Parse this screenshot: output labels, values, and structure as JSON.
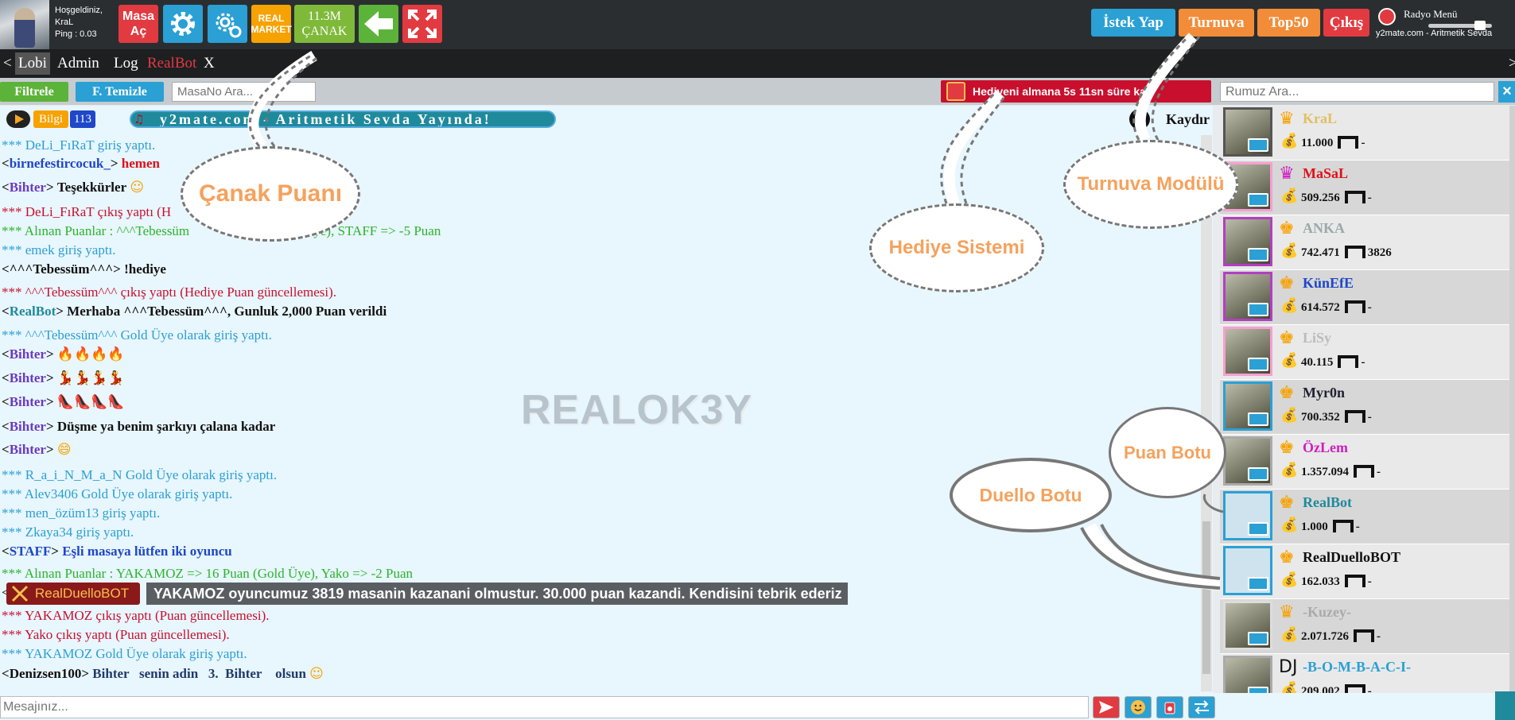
{
  "header": {
    "welcome": "Hoşgeldiniz,",
    "username": "KraL",
    "ping": "Ping : 0.03",
    "masa_ac": "Masa\nAç",
    "real_market": "REAL\nMARKET",
    "canak_value": "11.3M",
    "canak_label": "ÇANAK",
    "istek_yap": "İstek Yap",
    "turnuva": "Turnuva",
    "top50": "Top50",
    "cikis": "Çıkış",
    "radio_menu": "Radyo Menü",
    "radio_now": "y2mate.com - Aritmetik Sevda"
  },
  "tabs": {
    "prev": "<",
    "lobi": "Lobi",
    "admin": "Admin",
    "log": "Log",
    "realbot": "RealBot",
    "close": "X",
    "next": ">"
  },
  "filters": {
    "filtrele": "Filtrele",
    "temizle": "F. Temizle",
    "masa_placeholder": "MasaNo Ara...",
    "gift_text": "Hediyeni almana 5s 11sn süre ka",
    "rumuz_placeholder": "Rumuz Ara..."
  },
  "ticker": {
    "bilgi": "Bilgi",
    "count": "113",
    "marquee": "y2mate.com - Aritmetik Sevda  Yayında!",
    "kaydir": "Kaydır"
  },
  "chat": {
    "l1": "*** DeLi_FıRaT giriş yaptı.",
    "l2_nick": "birnefestircocuk_",
    "l2_msg": "hemen",
    "l3_nick": "Bihter",
    "l3_msg": "Teşekkürler",
    "l4": "*** DeLi_FıRaT çıkış yaptı (H",
    "l5": "*** Alınan Puanlar : ^^^Tebessüm",
    "l5b": "(Gold Üye), STAFF => -5 Puan",
    "l6": "*** emek giriş yaptı.",
    "l7_nick": "^^^Tebessüm^^^",
    "l7_msg": "!hediye",
    "l8": "*** ^^^Tebessüm^^^ çıkış yaptı (Hediye Puan güncellemesi).",
    "l9_nick": "RealBot",
    "l9_msg": "Merhaba ^^^Tebessüm^^^, Gunluk 2,000 Puan verildi",
    "l10": "*** ^^^Tebessüm^^^ Gold Üye olarak giriş yaptı.",
    "l11_nick": "Bihter",
    "l11_msg": "🔥🔥🔥🔥",
    "l12_nick": "Bihter",
    "l12_msg": "💃💃💃💃",
    "l13_nick": "Bihter",
    "l13_msg": "👠👠👠👠",
    "l14_nick": "Bihter",
    "l14_msg": "Düşme ya benim şarkıyı çalana kadar",
    "l15_nick": "Bihter",
    "l15_msg": "😄",
    "l16": "*** R_a_i_N_M_a_N Gold Üye olarak giriş yaptı.",
    "l17": "*** Alev3406 Gold Üye olarak giriş yaptı.",
    "l18": "*** men_özüm13 giriş yaptı.",
    "l19": "*** Zkaya34 giriş yaptı.",
    "l20_nick": "STAFF",
    "l20_msg": "Eşli masaya lütfen iki oyuncu",
    "l21": "*** Alınan Puanlar : YAKAMOZ => 16 Puan (Gold Üye), Yako => -2 Puan",
    "l22_nick": "RealDuelloBOT",
    "l22_msg": "YAKAMOZ oyuncumuz 3819 masanin kazanani olmustur. 30.000 puan kazandi. Kendisini tebrik ederiz",
    "l23": "*** YAKAMOZ çıkış yaptı (Puan güncellemesi).",
    "l24": "*** Yako çıkış yaptı (Puan güncellemesi).",
    "l25": "*** YAKAMOZ Gold Üye olarak giriş yaptı.",
    "l26_nick": "Denizsen100",
    "l26_msg": "Bihter   senin adin   3.  Bihter    olsun",
    "watermark": "REALOK3Y"
  },
  "users": [
    {
      "name": "KraL",
      "points": "11.000",
      "table": "-",
      "color": "#e0c060",
      "border": "#555"
    },
    {
      "name": "MaSaL",
      "points": "509.256",
      "table": "-",
      "color": "#e0101a",
      "border": "#f5a0d0"
    },
    {
      "name": "ANKA",
      "points": "742.471",
      "table": "3826",
      "color": "#9aa",
      "border": "#b040c0"
    },
    {
      "name": "KünEfE",
      "points": "614.572",
      "table": "-",
      "color": "#1f47c8",
      "border": "#b040c0"
    },
    {
      "name": "LiSy",
      "points": "40.115",
      "table": "-",
      "color": "#bbb",
      "border": "#f5a0d0"
    },
    {
      "name": "Myr0n",
      "points": "700.352",
      "table": "-",
      "color": "#223",
      "border": "#2aa0d4"
    },
    {
      "name": "ÖzLem",
      "points": "1.357.094",
      "table": "-",
      "color": "#d020c0",
      "border": "#aaa"
    },
    {
      "name": "RealBot",
      "points": "1.000",
      "table": "-",
      "color": "#1f8a9c",
      "border": "#2aa0d4"
    },
    {
      "name": "RealDuelloBOT",
      "points": "162.033",
      "table": "-",
      "color": "#111",
      "border": "#2aa0d4"
    },
    {
      "name": "-Kuzey-",
      "points": "2.071.726",
      "table": "-",
      "color": "#aaa",
      "border": "#ddd"
    },
    {
      "name": "-B-O-M-B-A-C-I-",
      "points": "209.002",
      "table": "-",
      "color": "#2aa0d4",
      "border": "#aaa"
    }
  ],
  "input": {
    "placeholder": "Mesajınız..."
  },
  "callouts": {
    "canak": "Çanak Puanı",
    "turnuva": "Turnuva Modülü",
    "hediye": "Hediye Sistemi",
    "puan": "Puan Botu",
    "duello": "Duello Botu"
  },
  "colors": {
    "topbar": "#2a2e31",
    "chat_bg": "#e8f6fd",
    "system_text": "#2aa0d4",
    "accent_red": "#e23a41",
    "accent_blue": "#2aa0d4",
    "accent_orange": "#f28c38",
    "callout_text": "#f5a25d"
  }
}
